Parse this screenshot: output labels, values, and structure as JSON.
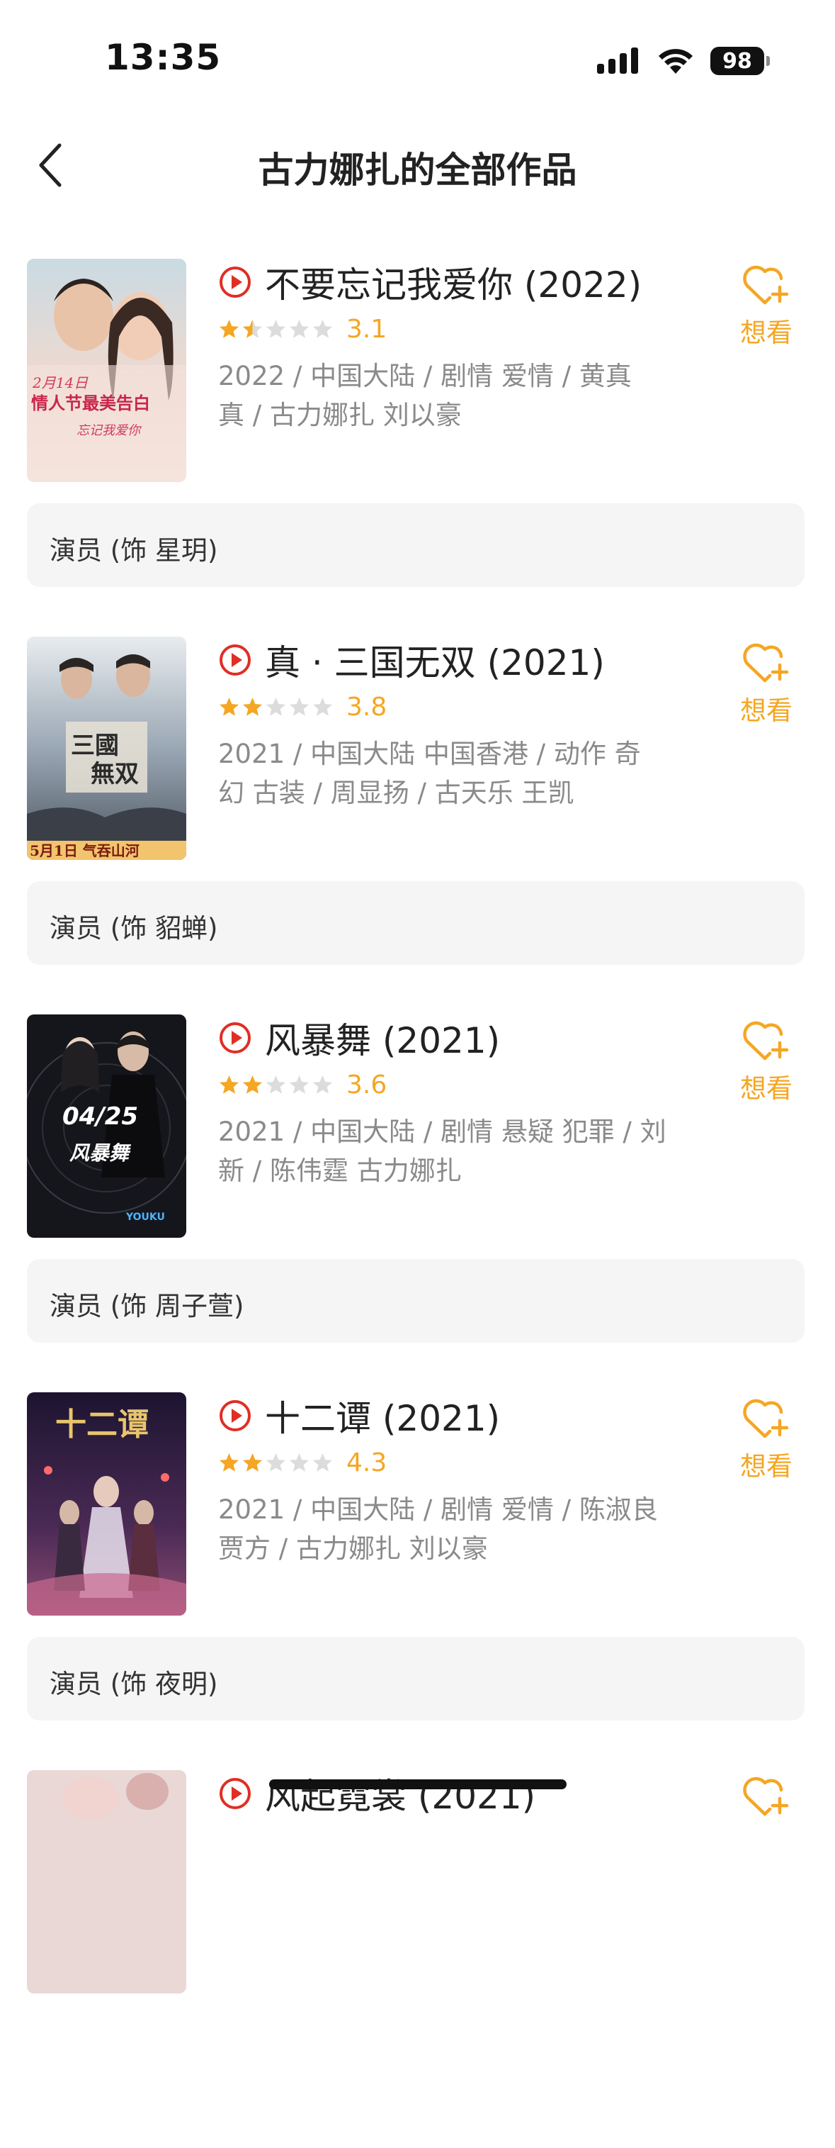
{
  "status_bar": {
    "time": "13:35",
    "battery": "98",
    "icons": [
      "cellular-signal-icon",
      "wifi-icon",
      "battery-icon"
    ]
  },
  "nav": {
    "title": "古力娜扎的全部作品",
    "back_icon": "chevron-left-icon"
  },
  "colors": {
    "accent_orange": "#f5a623",
    "play_red": "#e02e24",
    "meta_gray": "#8a8a8a",
    "role_bg": "#f5f5f5"
  },
  "want_label": "想看",
  "items": [
    {
      "title": "不要忘记我爱你 (2022)",
      "score": "3.1",
      "stars": 1.5,
      "meta_line1": "2022 / 中国大陆 / 剧情 爱情 / 黄真",
      "meta_line2": "真 / 古力娜扎 刘以豪",
      "role": "演员 (饰 星玥)",
      "poster_text": "2月14日 情人节最美告白"
    },
    {
      "title": "真 · 三国无双 (2021)",
      "score": "3.8",
      "stars": 2,
      "meta_line1": "2021 / 中国大陆 中国香港 / 动作 奇",
      "meta_line2": "幻 古装 / 周显扬 / 古天乐 王凯",
      "role": "演员 (饰 貂蝉)",
      "poster_text": "5月1日 气吞山河"
    },
    {
      "title": "风暴舞 (2021)",
      "score": "3.6",
      "stars": 2,
      "meta_line1": "2021 / 中国大陆 / 剧情 悬疑 犯罪 / 刘",
      "meta_line2": "新 / 陈伟霆 古力娜扎",
      "role": "演员 (饰 周子萱)",
      "poster_text": "04/25 风暴舞"
    },
    {
      "title": "十二谭 (2021)",
      "score": "4.3",
      "stars": 2,
      "meta_line1": "2021 / 中国大陆 / 剧情 爱情 / 陈淑良",
      "meta_line2": "贾方 / 古力娜扎 刘以豪",
      "role": "演员 (饰 夜明)",
      "poster_text": "十二谭"
    },
    {
      "title": "风起霓裳 (2021)",
      "score": "",
      "stars": 0,
      "meta_line1": "",
      "meta_line2": "",
      "role": "",
      "poster_text": ""
    }
  ]
}
